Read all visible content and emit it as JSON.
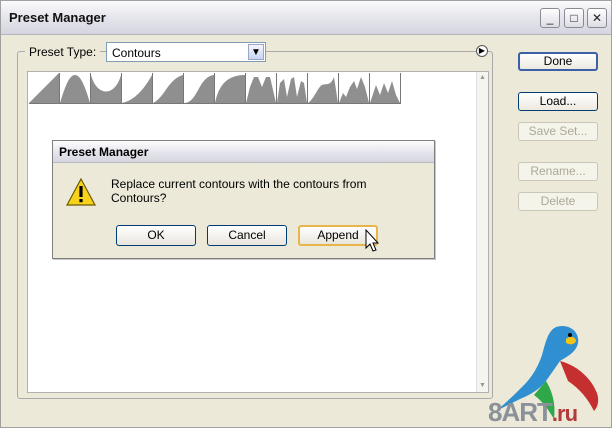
{
  "window": {
    "title": "Preset Manager",
    "controls": {
      "minimize": "_",
      "maximize": "□",
      "close": "✕"
    }
  },
  "preset_type": {
    "label": "Preset Type:",
    "value": "Contours"
  },
  "side_buttons": {
    "done": "Done",
    "load": "Load...",
    "save_set": "Save Set...",
    "rename": "Rename...",
    "delete": "Delete"
  },
  "dialog": {
    "title": "Preset Manager",
    "message": "Replace current contours with the contours from Contours?",
    "ok": "OK",
    "cancel": "Cancel",
    "append": "Append"
  },
  "watermark": {
    "brand": "8ART",
    "tld": ".ru"
  },
  "colors": {
    "accent": "#3c5fa8",
    "focus": "#e8b54a",
    "thumb_fill": "#8f8f8f"
  }
}
